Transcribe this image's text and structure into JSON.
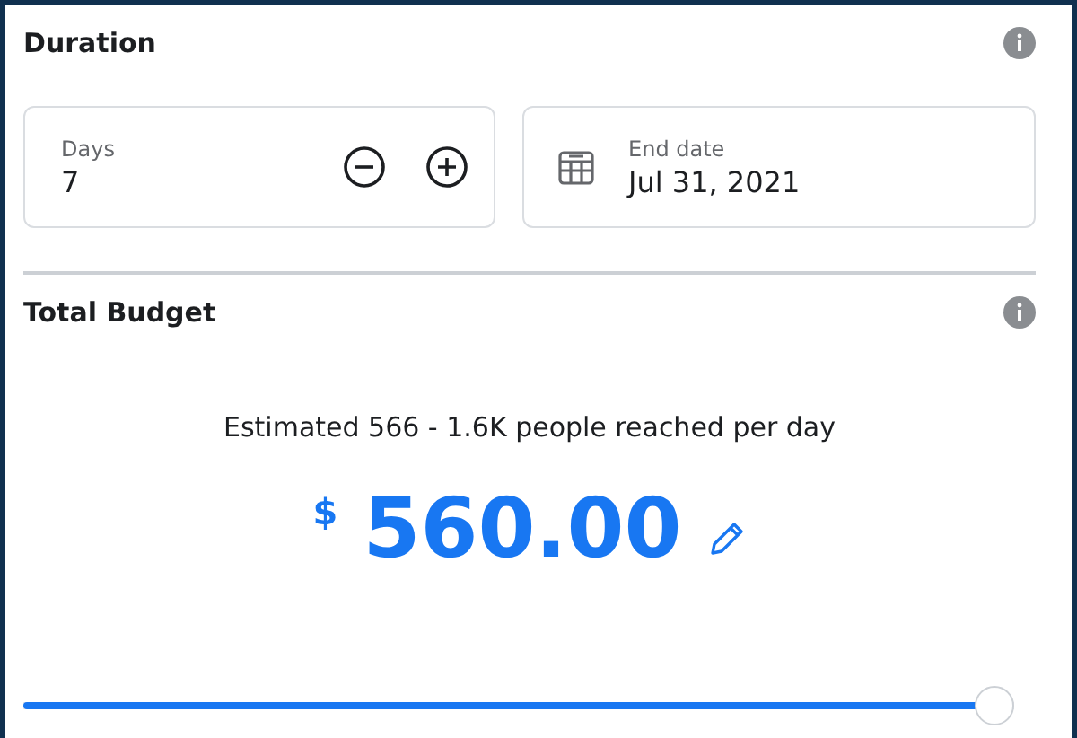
{
  "duration": {
    "title": "Duration",
    "days": {
      "label": "Days",
      "value": "7"
    },
    "end_date": {
      "label": "End date",
      "value": "Jul 31, 2021"
    }
  },
  "budget": {
    "title": "Total Budget",
    "estimate": "Estimated 566 - 1.6K people reached per day",
    "currency": "$",
    "amount": "560.00",
    "slider": {
      "level": 0.98
    }
  }
}
